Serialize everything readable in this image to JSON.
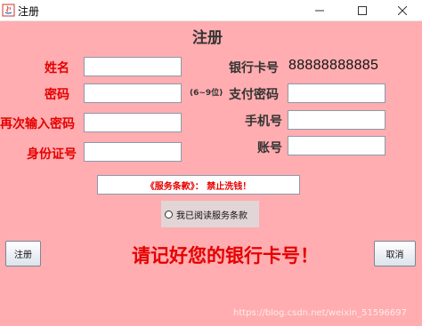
{
  "window": {
    "title": "注册",
    "controls": {
      "minimize": "minimize-icon",
      "maximize": "maximize-icon",
      "close": "close-icon"
    }
  },
  "form": {
    "title": "注册",
    "name_label": "姓名",
    "name_value": "",
    "password_label": "密码",
    "password_value": "",
    "password_hint": "(6~9位)",
    "confirm_label": "再次输入密码",
    "confirm_value": "",
    "id_label": "身份证号",
    "id_value": "",
    "card_label": "银行卡号",
    "card_number": "88888888885",
    "pay_password_label": "支付密码",
    "pay_password_value": "",
    "phone_label": "手机号",
    "phone_value": "",
    "account_label": "账号",
    "account_value": ""
  },
  "terms": {
    "text": "《服务条款》： 禁止洗钱！",
    "agree_label": "我已阅读服务条款",
    "agree_checked": false
  },
  "buttons": {
    "register": "注册",
    "cancel": "取消"
  },
  "reminder": "请记好您的银行卡号！",
  "watermark": "https://blog.csdn.net/weixin_51596697",
  "colors": {
    "background": "#ffadb0",
    "label_red": "#e60000",
    "label_dark": "#333333"
  }
}
